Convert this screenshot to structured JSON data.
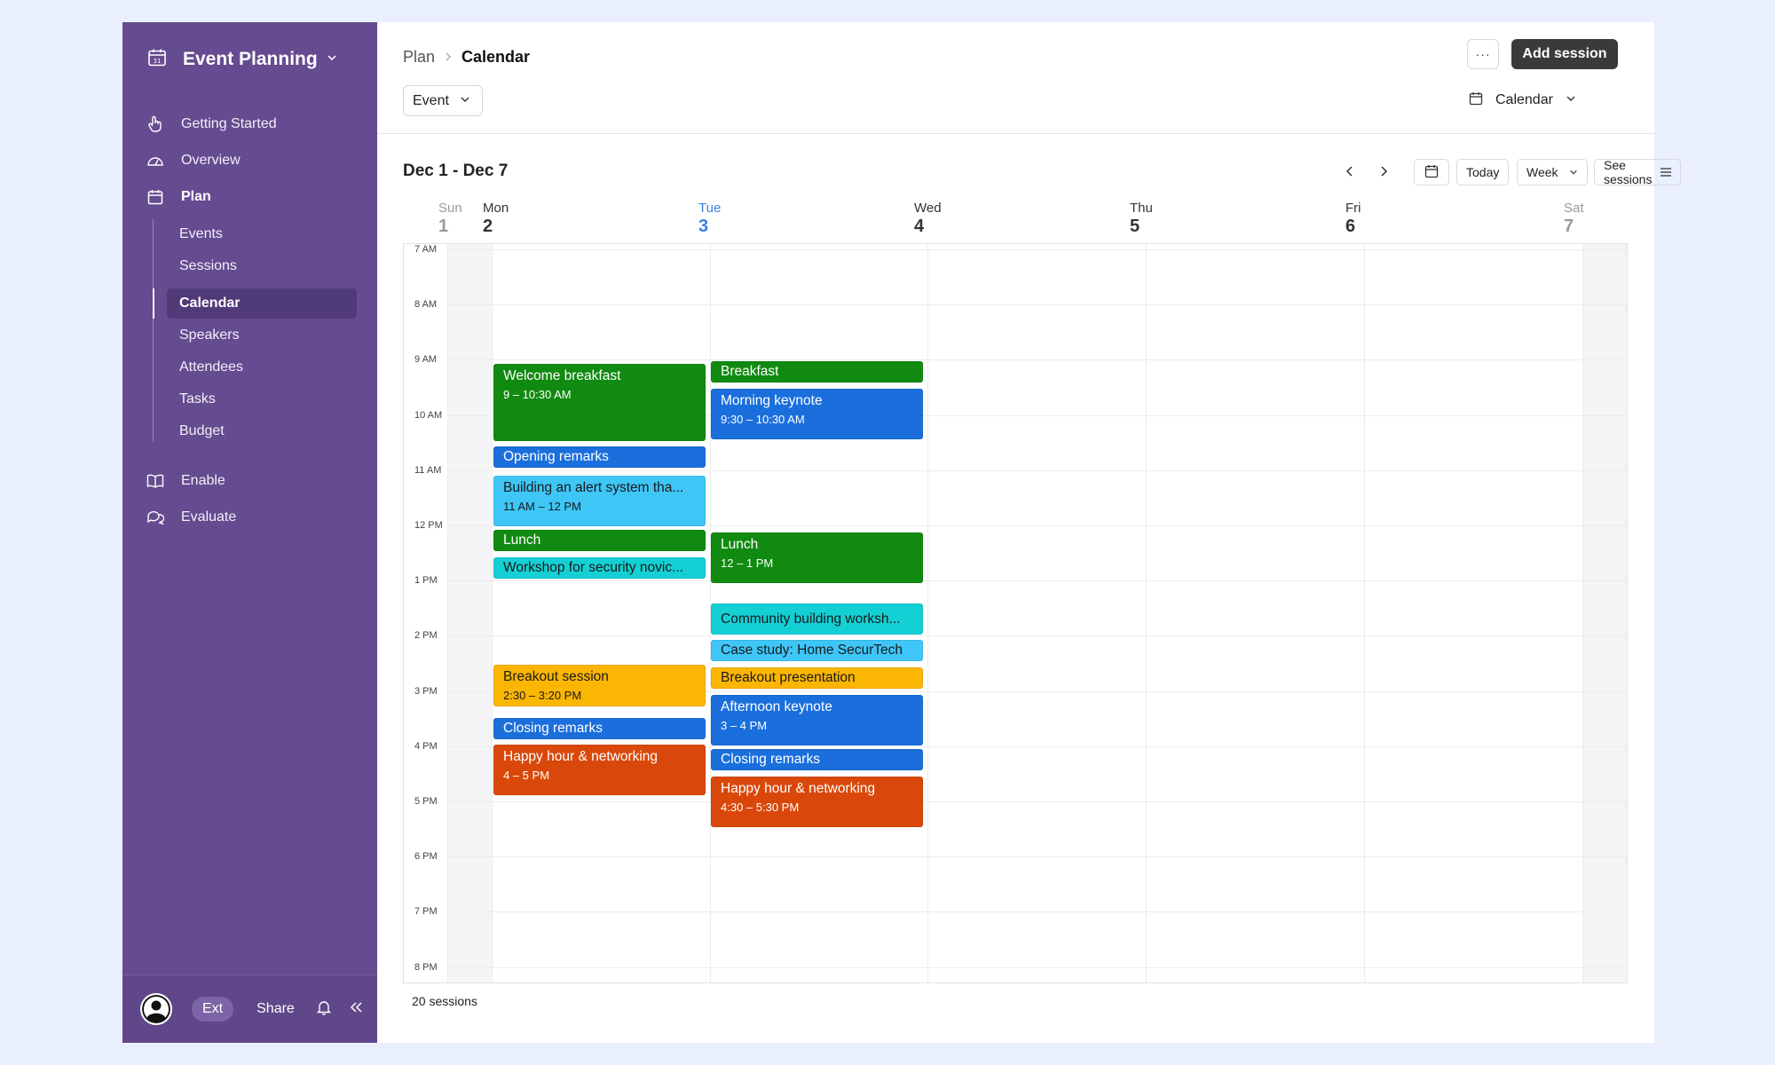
{
  "sidebar": {
    "title": "Event Planning",
    "nav": [
      {
        "label": "Getting Started",
        "icon": "hand-pointer-icon"
      },
      {
        "label": "Overview",
        "icon": "gauge-icon"
      },
      {
        "label": "Plan",
        "icon": "calendar-icon"
      }
    ],
    "subnav": [
      "Events",
      "Sessions",
      "Calendar",
      "Speakers",
      "Attendees",
      "Tasks",
      "Budget"
    ],
    "active_sub": "Calendar",
    "nav2": [
      {
        "label": "Enable",
        "icon": "book-icon"
      },
      {
        "label": "Evaluate",
        "icon": "chat-bubbles-icon"
      }
    ],
    "bottom": {
      "pill": "Ext",
      "share": "Share"
    },
    "bg_color": "#654b8f"
  },
  "header": {
    "breadcrumb": [
      "Plan",
      "Calendar"
    ],
    "more_label": "···",
    "add_label": "Add session",
    "event_filter": "Event",
    "view_label": "Calendar"
  },
  "calendar": {
    "range": "Dec 1 - Dec 7",
    "today_label": "Today",
    "week_label": "Week",
    "see_sessions_label": "See sessions",
    "days": [
      {
        "name": "Sun",
        "num": "1"
      },
      {
        "name": "Mon",
        "num": "2"
      },
      {
        "name": "Tue",
        "num": "3"
      },
      {
        "name": "Wed",
        "num": "4"
      },
      {
        "name": "Thu",
        "num": "5"
      },
      {
        "name": "Fri",
        "num": "6"
      },
      {
        "name": "Sat",
        "num": "7"
      }
    ],
    "hours": [
      "7 AM",
      "8 AM",
      "9 AM",
      "10 AM",
      "11 AM",
      "12 PM",
      "1 PM",
      "2 PM",
      "3 PM",
      "4 PM",
      "5 PM",
      "6 PM",
      "7 PM",
      "8 PM"
    ],
    "events": [
      {
        "day": 1,
        "title": "Welcome breakfast",
        "time": "9  – 10:30 AM",
        "color": "#118a11"
      },
      {
        "day": 1,
        "title": "Opening remarks",
        "time": "",
        "color": "#1a6fdc"
      },
      {
        "day": 1,
        "title": "Building an alert system tha...",
        "time": "11 AM – 12 PM",
        "color": "#3ec6f7"
      },
      {
        "day": 1,
        "title": "Lunch",
        "time": "",
        "color": "#118a11"
      },
      {
        "day": 1,
        "title": "Workshop for security novic...",
        "time": "",
        "color": "#14d0d4"
      },
      {
        "day": 1,
        "title": "Breakout session",
        "time": "2:30  – 3:20 PM",
        "color": "#fbb604"
      },
      {
        "day": 1,
        "title": "Closing remarks",
        "time": "",
        "color": "#1a6fdc"
      },
      {
        "day": 1,
        "title": "Happy hour & networking",
        "time": "4  – 5 PM",
        "color": "#d9480a"
      },
      {
        "day": 2,
        "title": "Breakfast",
        "time": "",
        "color": "#118a11"
      },
      {
        "day": 2,
        "title": "Morning keynote",
        "time": "9:30  – 10:30 AM",
        "color": "#1a6fdc"
      },
      {
        "day": 2,
        "title": "Lunch",
        "time": "12  – 1 PM",
        "color": "#118a11"
      },
      {
        "day": 2,
        "title": "Community building worksh...",
        "time": "",
        "color": "#14d0d4"
      },
      {
        "day": 2,
        "title": "Case study: Home SecurTech",
        "time": "",
        "color": "#3ec6f7"
      },
      {
        "day": 2,
        "title": "Breakout presentation",
        "time": "",
        "color": "#fbb604"
      },
      {
        "day": 2,
        "title": "Afternoon keynote",
        "time": "3  – 4 PM",
        "color": "#1a6fdc"
      },
      {
        "day": 2,
        "title": "Closing remarks",
        "time": "",
        "color": "#1a6fdc"
      },
      {
        "day": 2,
        "title": "Happy hour & networking",
        "time": "4:30  – 5:30 PM",
        "color": "#d9480a"
      }
    ],
    "count_label": "20 sessions"
  }
}
